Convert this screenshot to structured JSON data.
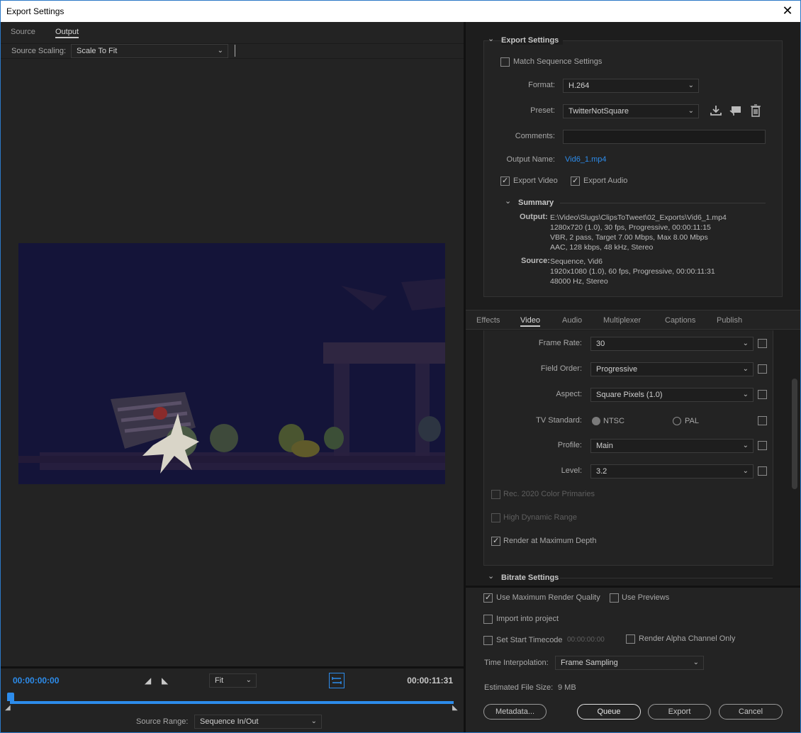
{
  "window": {
    "title": "Export Settings",
    "close_glyph": "✕"
  },
  "left_tabs": [
    {
      "label": "Source"
    },
    {
      "label": "Output"
    }
  ],
  "source_scaling": {
    "label": "Source Scaling:",
    "value": "Scale To Fit"
  },
  "timeline": {
    "current_time": "00:00:00:00",
    "end_time": "00:00:11:31",
    "zoom": "Fit",
    "source_range_label": "Source Range:",
    "source_range_value": "Sequence In/Out",
    "playhead_progress": 0,
    "accent_color": "#2d8ceb"
  },
  "export_settings": {
    "header": "Export Settings",
    "match_sequence": {
      "label": "Match Sequence Settings",
      "checked": false
    },
    "format": {
      "label": "Format:",
      "value": "H.264"
    },
    "preset": {
      "label": "Preset:",
      "value": "TwitterNotSquare"
    },
    "comments": {
      "label": "Comments:",
      "value": ""
    },
    "output_name": {
      "label": "Output Name:",
      "value": "Vid6_1.mp4"
    },
    "export_video": {
      "label": "Export Video",
      "checked": true
    },
    "export_audio": {
      "label": "Export Audio",
      "checked": true
    },
    "summary": {
      "header": "Summary",
      "output_label": "Output:",
      "output_lines": [
        "E:\\Video\\Slugs\\ClipsToTweet\\02_Exports\\Vid6_1.mp4",
        "1280x720 (1.0), 30 fps, Progressive, 00:00:11:15",
        "VBR, 2 pass, Target 7.00 Mbps, Max 8.00 Mbps",
        "AAC, 128 kbps, 48 kHz, Stereo"
      ],
      "source_label": "Source:",
      "source_lines": [
        "Sequence, Vid6",
        "1920x1080 (1.0), 60 fps, Progressive, 00:00:11:31",
        "48000 Hz, Stereo"
      ]
    }
  },
  "settings_tabs": [
    {
      "label": "Effects"
    },
    {
      "label": "Video"
    },
    {
      "label": "Audio"
    },
    {
      "label": "Multiplexer"
    },
    {
      "label": "Captions"
    },
    {
      "label": "Publish"
    }
  ],
  "video": {
    "frame_rate": {
      "label": "Frame Rate:",
      "value": "30"
    },
    "field_order": {
      "label": "Field Order:",
      "value": "Progressive"
    },
    "aspect": {
      "label": "Aspect:",
      "value": "Square Pixels (1.0)"
    },
    "tv_standard": {
      "label": "TV Standard:",
      "ntsc": "NTSC",
      "pal": "PAL",
      "selected": "NTSC"
    },
    "profile": {
      "label": "Profile:",
      "value": "Main"
    },
    "level": {
      "label": "Level:",
      "value": "3.2"
    },
    "rec2020": {
      "label": "Rec. 2020 Color Primaries",
      "checked": false
    },
    "hdr": {
      "label": "High Dynamic Range",
      "checked": false
    },
    "max_depth": {
      "label": "Render at Maximum Depth",
      "checked": true
    },
    "bitrate_header": "Bitrate Settings"
  },
  "bottom": {
    "max_render_quality": {
      "label": "Use Maximum Render Quality",
      "checked": true
    },
    "use_previews": {
      "label": "Use Previews",
      "checked": false
    },
    "import_project": {
      "label": "Import into project",
      "checked": false
    },
    "start_timecode": {
      "label": "Set Start Timecode",
      "checked": false,
      "value": "00:00:00:00"
    },
    "alpha_only": {
      "label": "Render Alpha Channel Only",
      "checked": false
    },
    "time_interp": {
      "label": "Time Interpolation:",
      "value": "Frame Sampling"
    },
    "file_size": {
      "label": "Estimated File Size:",
      "value": "9 MB"
    },
    "buttons": {
      "metadata": "Metadata...",
      "queue": "Queue",
      "export": "Export",
      "cancel": "Cancel"
    }
  }
}
